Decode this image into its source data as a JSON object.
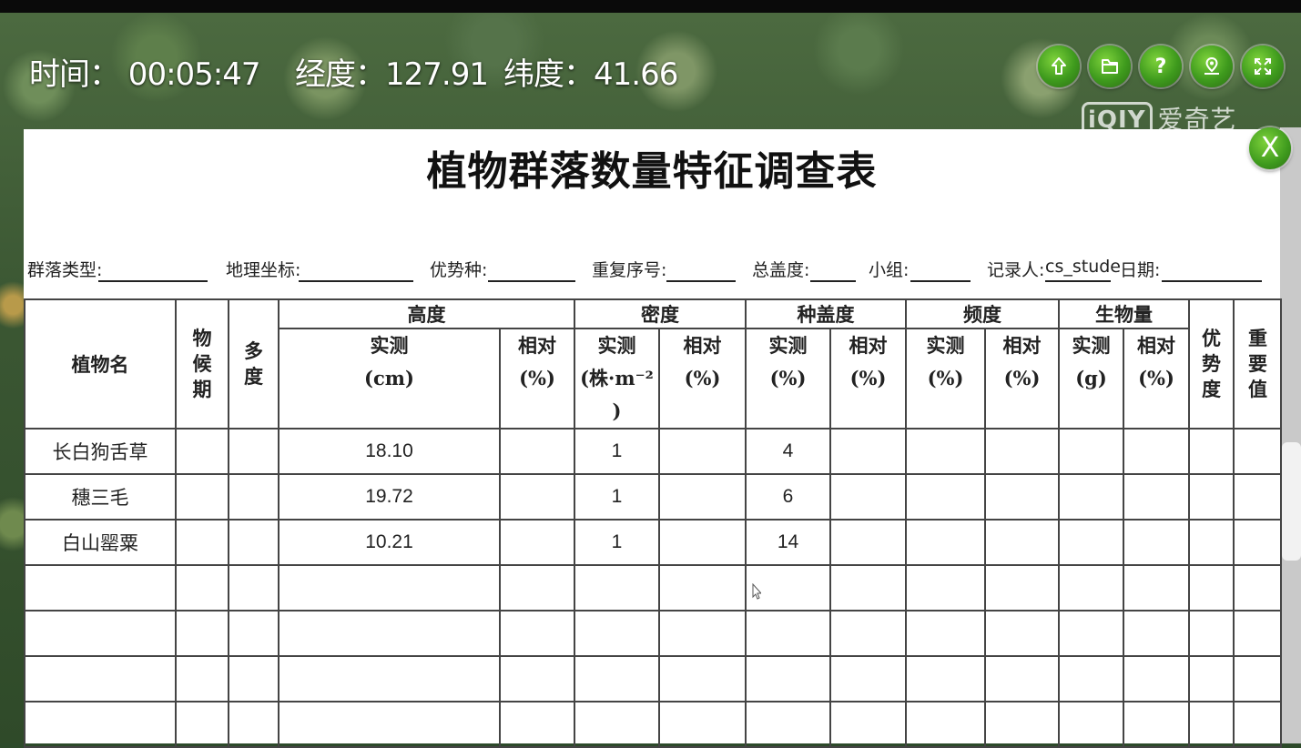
{
  "hud": {
    "time": "时间：  00:05:47",
    "longitude": "经度：127.91",
    "latitude": "纬度：41.66"
  },
  "toolbar": {
    "icons": [
      "upload-icon",
      "folder-icon",
      "help-icon",
      "map-pin-icon",
      "fullscreen-icon"
    ],
    "help_glyph": "?",
    "close_glyph": "X"
  },
  "watermark": {
    "logo": "iQIY",
    "text": "爱奇艺"
  },
  "form": {
    "title": "植物群落数量特征调查表",
    "fields": {
      "community_type": "群落类型:",
      "coordinates": "地理坐标:",
      "dominant_species": "优势种:",
      "repeat_no": "重复序号:",
      "total_coverage": "总盖度:",
      "group": "小组:",
      "recorder_label": "记录人:",
      "recorder_value": "cs_stude",
      "date": "日期:"
    },
    "headers": {
      "plant_name": "植物名",
      "phenology": "物候期",
      "abundance": "多度",
      "height": "高度",
      "density": "密度",
      "coverage": "种盖度",
      "frequency": "频度",
      "biomass": "生物量",
      "dominance": "优势度",
      "importance": "重要值",
      "measured_cm": "实测\n(cm)",
      "measured_density": "实测\n(株·m⁻²\n)",
      "measured_pct": "实测\n(%)",
      "measured_g": "实测\n(g)",
      "relative_pct": "相对\n(%)"
    },
    "rows": [
      {
        "name": "长白狗舌草",
        "height": "18.10",
        "density": "1",
        "coverage": "4"
      },
      {
        "name": "穗三毛",
        "height": "19.72",
        "density": "1",
        "coverage": "6"
      },
      {
        "name": "白山罂粟",
        "height": "10.21",
        "density": "1",
        "coverage": "14"
      }
    ]
  },
  "colors": {
    "button_green": "#3e9a1d",
    "sheet": "#ffffff",
    "ink": "#222222"
  }
}
